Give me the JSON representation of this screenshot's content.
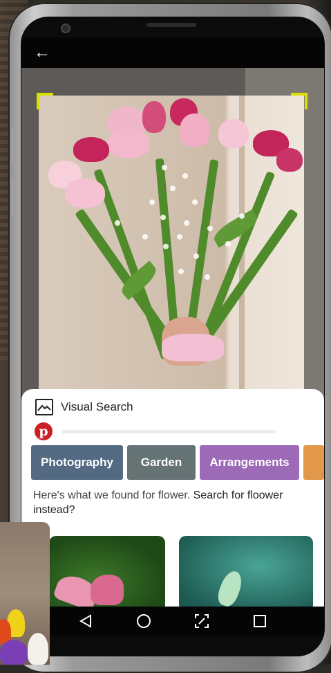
{
  "screen": {
    "back_icon": "arrow-left-icon",
    "bracket_color": "#d7e000"
  },
  "sheet": {
    "title": "Visual Search",
    "title_icon": "image-icon",
    "brand_icon": "pinterest-icon",
    "brand_glyph": "p",
    "chips": [
      {
        "label": "Photography",
        "color": "#536a82"
      },
      {
        "label": "Garden",
        "color": "#667375"
      },
      {
        "label": "Arrangements",
        "color": "#9c6ab7"
      },
      {
        "label": "",
        "color": "#e2984a"
      }
    ],
    "found_text": "Here's what we found for flower.",
    "suggest_link": "Search for floower instead?"
  },
  "navbar": {
    "back": "nav-back-icon",
    "home": "nav-home-icon",
    "capture": "screen-capture-icon",
    "recents": "nav-recents-icon"
  }
}
